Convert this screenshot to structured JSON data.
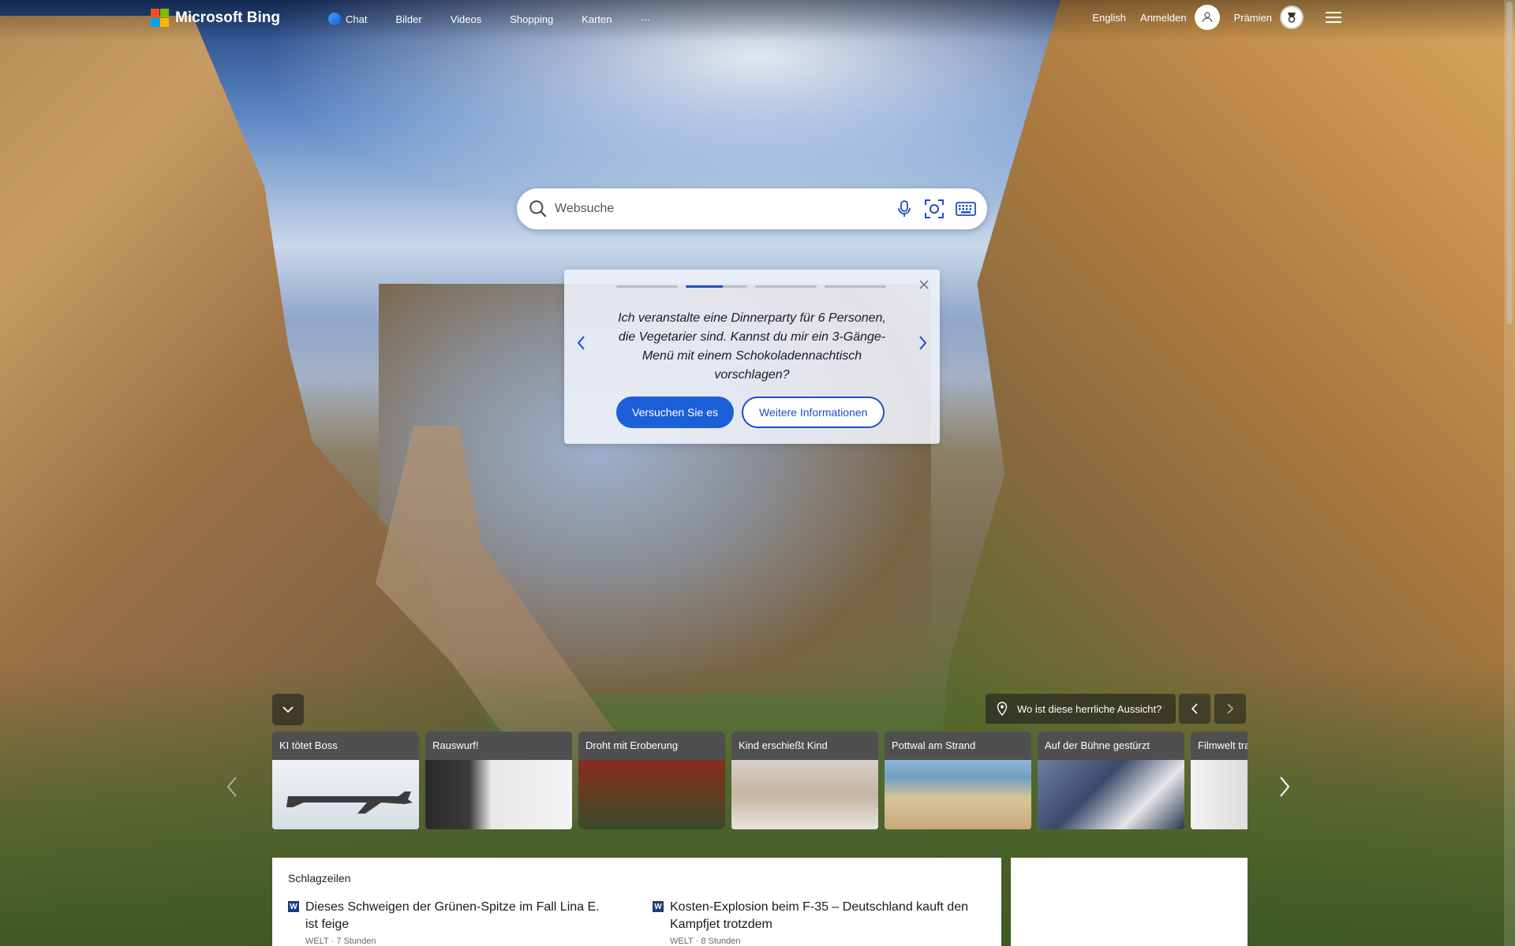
{
  "brand": {
    "name": "Microsoft Bing"
  },
  "nav": {
    "items": [
      {
        "label": "Chat",
        "icon": "chat-icon"
      },
      {
        "label": "Bilder"
      },
      {
        "label": "Videos"
      },
      {
        "label": "Shopping"
      },
      {
        "label": "Karten"
      },
      {
        "label": "···"
      }
    ]
  },
  "header": {
    "language": "English",
    "signin": "Anmelden",
    "rewards": "Prämien",
    "icons": [
      "user-icon",
      "rewards-icon",
      "menu-icon"
    ]
  },
  "search": {
    "placeholder": "Websuche",
    "icons": [
      "search-icon",
      "microphone-icon",
      "visual-search-icon",
      "keyboard-icon"
    ]
  },
  "promo": {
    "slides_total": 4,
    "active_slide": 2,
    "text": "Ich veranstalte eine Dinnerparty für 6 Personen, die Vegetarier sind. Kannst du mir ein 3-Gänge-Menü mit einem Schokoladennachtisch vorschlagen?",
    "primary_button": "Versuchen Sie es",
    "secondary_button": "Weitere Informationen"
  },
  "image_info": {
    "location_question": "Wo ist diese herrliche Aussicht?"
  },
  "carousel": {
    "cards": [
      {
        "title": "KI tötet Boss"
      },
      {
        "title": "Rauswurf!"
      },
      {
        "title": "Droht mit Eroberung"
      },
      {
        "title": "Kind erschießt Kind"
      },
      {
        "title": "Pottwal am Strand"
      },
      {
        "title": "Auf der Bühne gestürzt"
      },
      {
        "title": "Filmwelt tra"
      }
    ]
  },
  "news": {
    "section_title": "Schlagzeilen",
    "items": [
      {
        "source_badge": "W",
        "title": "Dieses Schweigen der Grünen-Spitze im Fall Lina E. ist feige",
        "meta": "WELT · 7 Stunden"
      },
      {
        "source_badge": "W",
        "title": "Kosten-Explosion beim F-35 – Deutschland kauft den Kampfjet trotzdem",
        "meta": "WELT · 8 Stunden"
      }
    ]
  },
  "colors": {
    "accent": "#1b5fd9",
    "ms_red": "#f25022",
    "ms_green": "#7fba00",
    "ms_blue": "#00a4ef",
    "ms_yellow": "#ffb900"
  }
}
